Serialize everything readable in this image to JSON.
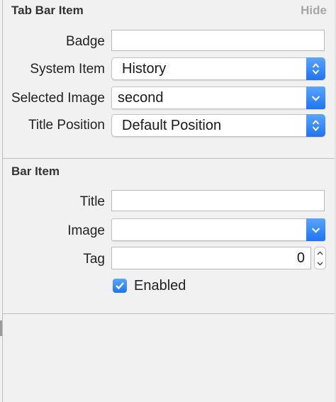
{
  "tab_bar_item": {
    "title": "Tab Bar Item",
    "hide_label": "Hide",
    "badge_label": "Badge",
    "badge_value": "",
    "system_item_label": "System Item",
    "system_item_value": "History",
    "selected_image_label": "Selected Image",
    "selected_image_value": "second",
    "title_position_label": "Title Position",
    "title_position_value": "Default Position"
  },
  "bar_item": {
    "title": "Bar Item",
    "title_label": "Title",
    "title_value": "",
    "image_label": "Image",
    "image_value": "",
    "tag_label": "Tag",
    "tag_value": "0",
    "enabled_label": "Enabled",
    "enabled_checked": true
  },
  "colors": {
    "accent": "#2f80f5",
    "panel_bg": "#f1f1f1",
    "hide_link": "#a6a6a6"
  }
}
